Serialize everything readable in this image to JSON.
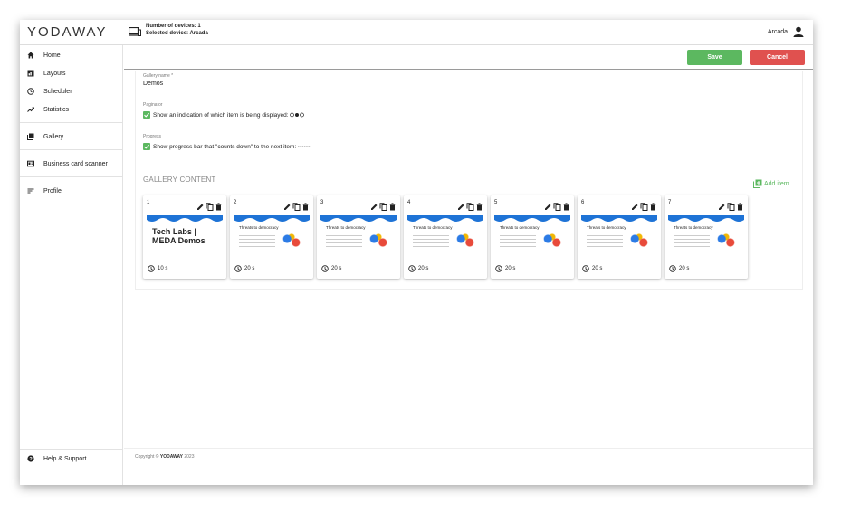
{
  "header": {
    "logo": "YODAWAY",
    "devices_count": "Number of devices: 1",
    "selected_device": "Selected device: Arcada",
    "user": "Arcada"
  },
  "sidebar": {
    "items": [
      {
        "label": "Home",
        "icon": "home-icon"
      },
      {
        "label": "Layouts",
        "icon": "layouts-icon"
      },
      {
        "label": "Scheduler",
        "icon": "clock-icon"
      },
      {
        "label": "Statistics",
        "icon": "trending-icon"
      },
      {
        "label": "Gallery",
        "icon": "gallery-icon"
      },
      {
        "label": "Business card scanner",
        "icon": "card-scanner-icon"
      },
      {
        "label": "Profile",
        "icon": "profile-icon"
      }
    ],
    "help": "Help & Support"
  },
  "actions": {
    "save": "Save",
    "cancel": "Cancel"
  },
  "form": {
    "gallery_name_label": "Gallery name *",
    "gallery_name_value": "Demos",
    "paginator_label": "Paginator",
    "paginator_text": "Show an indication of which item is being displayed:",
    "paginator_checked": true,
    "progress_label": "Progress",
    "progress_text": "Show progress bar that \"counts down\" to the next item:",
    "progress_checked": true
  },
  "gallery": {
    "title": "GALLERY CONTENT",
    "add_item": "Add item",
    "items": [
      {
        "num": "1",
        "duration": "10 s",
        "thumb_title": "Tech Labs | MEDA Demos"
      },
      {
        "num": "2",
        "duration": "20 s",
        "thumb_title": "Threats to democracy"
      },
      {
        "num": "3",
        "duration": "20 s",
        "thumb_title": "Threats to democracy"
      },
      {
        "num": "4",
        "duration": "20 s",
        "thumb_title": "Threats to democracy"
      },
      {
        "num": "5",
        "duration": "20 s",
        "thumb_title": "Threats to democracy"
      },
      {
        "num": "6",
        "duration": "20 s",
        "thumb_title": "Threats to democracy"
      },
      {
        "num": "7",
        "duration": "20 s",
        "thumb_title": "Threats to democracy"
      }
    ]
  },
  "footer": {
    "prefix": "Copyright ©",
    "brand": "YODAWAY",
    "year": "2023"
  },
  "colors": {
    "accent_green": "#5cb860",
    "cancel_red": "#e0514f",
    "wave_blue": "#1e73d6"
  }
}
